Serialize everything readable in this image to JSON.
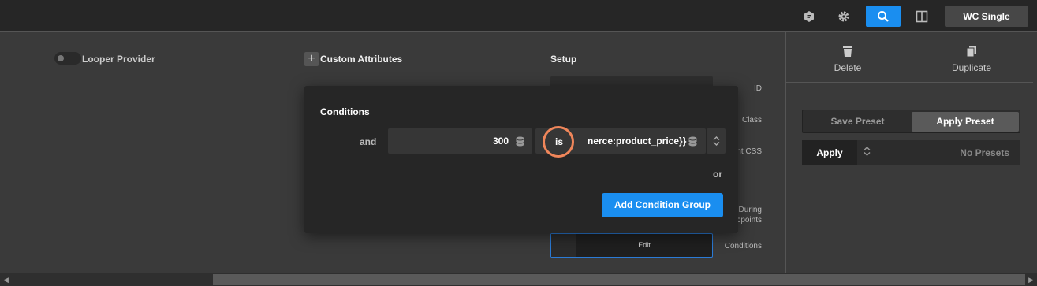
{
  "topbar": {
    "icons": [
      "shield-icon",
      "gear-icon",
      "search-icon",
      "layout-icon"
    ],
    "template_button": "WC Single"
  },
  "main": {
    "looper_label": "Looper Provider",
    "custom_attributes_label": "Custom Attributes",
    "setup_label": "Setup",
    "setup_labels": {
      "id": "ID",
      "class": "Class",
      "element_css": "ent CSS",
      "during_line1": "During",
      "during_line2": "cpoints",
      "conditions": "Conditions"
    },
    "edit_label": "Edit"
  },
  "right_panel": {
    "delete_label": "Delete",
    "duplicate_label": "Duplicate",
    "save_preset": "Save Preset",
    "apply_preset": "Apply Preset",
    "apply_label": "Apply",
    "no_presets": "No Presets"
  },
  "conditions_popup": {
    "title": "Conditions",
    "and_label": "and",
    "value_field": "300",
    "operator": "is",
    "dynamic_field": "nerce:product_price}}",
    "or_label": "or",
    "add_group_button": "Add Condition Group"
  },
  "colors": {
    "accent": "#1a8ef0",
    "highlight_circle": "#f0865a",
    "edit_border": "#2b7bd6"
  }
}
